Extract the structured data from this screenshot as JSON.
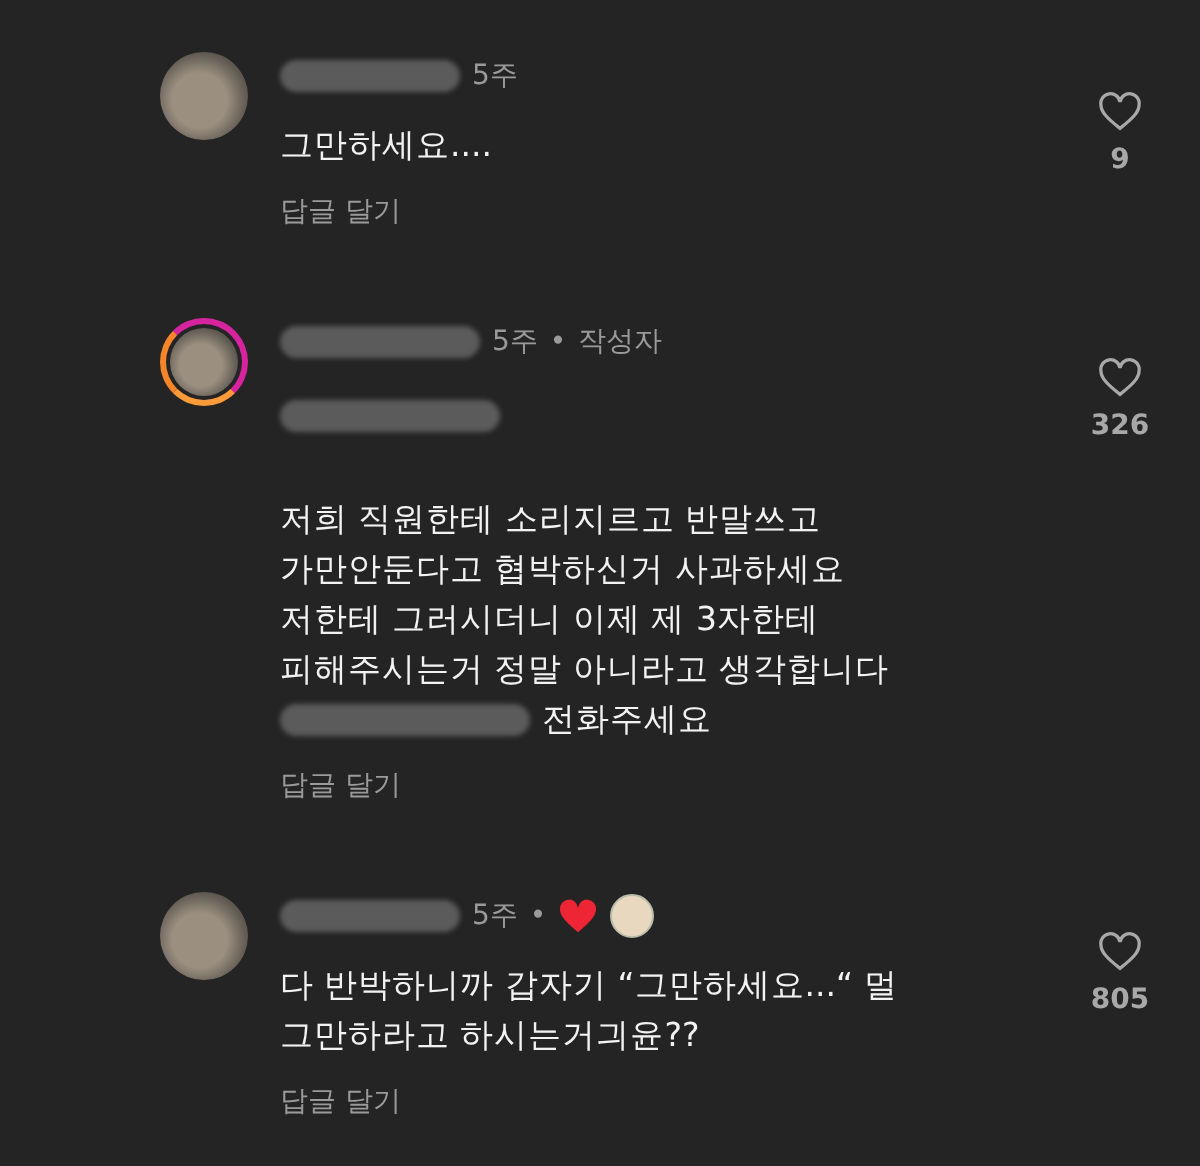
{
  "comments": [
    {
      "time": "5주",
      "story_ring": false,
      "liked_by_author": false,
      "mention_redacted": false,
      "text_lines": [
        "그만하세요...."
      ],
      "reply": "답글 달기",
      "likes": "9"
    },
    {
      "time": "5주",
      "separator": "•",
      "author_label": "작성자",
      "story_ring": true,
      "liked_by_author": false,
      "mention_redacted": true,
      "text_lines": [
        "저희 직원한테 소리지르고 반말쓰고",
        "가만안둔다고 협박하신거 사과하세요",
        "저한테 그러시더니 이제 제 3자한테",
        "피해주시는거 정말 아니라고 생각합니다"
      ],
      "redacted_line": "전화주세요",
      "reply": "답글 달기",
      "likes": "326"
    },
    {
      "time": "5주",
      "separator": "•",
      "story_ring": false,
      "liked_by_author": true,
      "mention_redacted": false,
      "text_lines": [
        "다 반박하니까 갑자기 “그만하세요...“ 멀",
        "그만하라고 하시는거긔윤??"
      ],
      "reply": "답글 달기",
      "likes": "805"
    }
  ]
}
